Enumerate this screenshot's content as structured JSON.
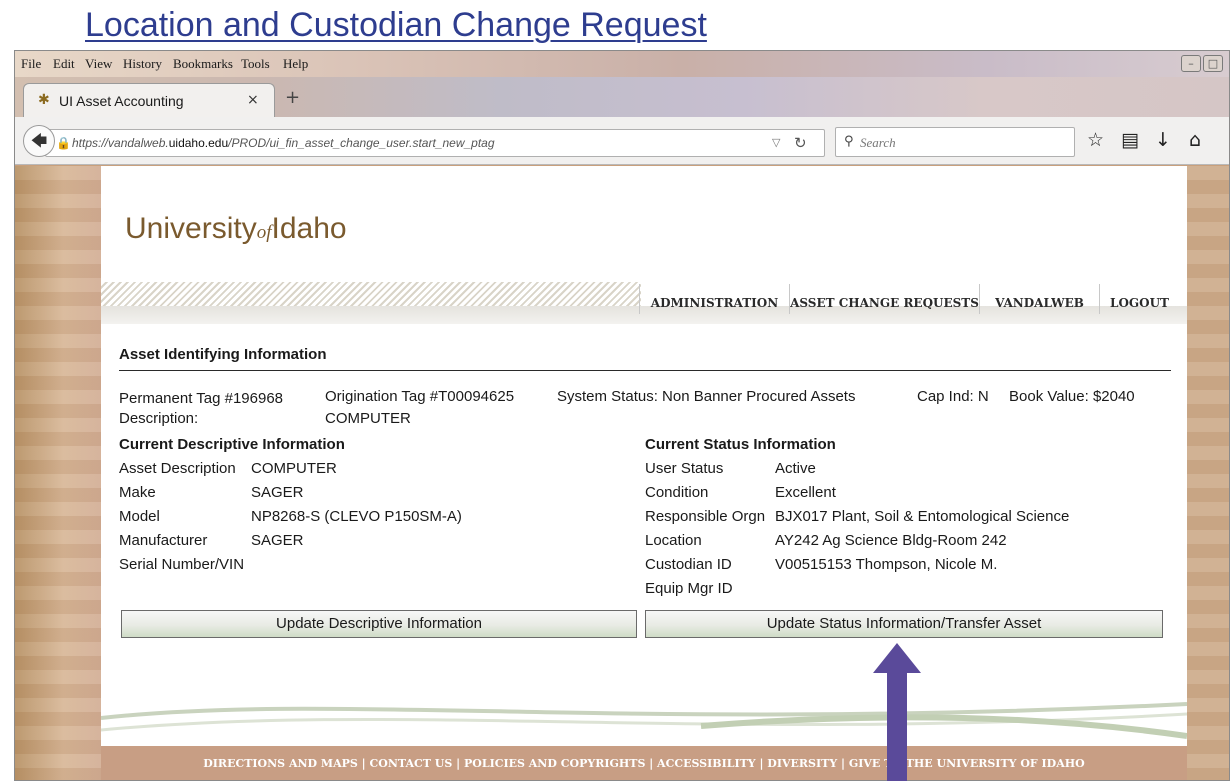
{
  "heading": "Location and Custodian Change Request",
  "menubar": {
    "items": [
      "File",
      "Edit",
      "View",
      "History",
      "Bookmarks",
      "Tools",
      "Help"
    ]
  },
  "tab": {
    "title": "UI Asset Accounting",
    "close": "×",
    "new_tab": "+"
  },
  "navbar": {
    "url_domain": "https://vandalweb.",
    "url_host": "uidaho.edu",
    "url_path": "/PROD/ui_fin_asset_change_user.start_new_ptag",
    "search_placeholder": "Search"
  },
  "site": {
    "logo_main": "University",
    "logo_of": "of",
    "logo_end": "Idaho",
    "nav": [
      "ADMINISTRATION",
      "ASSET CHANGE REQUESTS",
      "VANDALWEB",
      "LOGOUT"
    ]
  },
  "asset": {
    "section_title": "Asset Identifying Information",
    "permanent_tag": "Permanent Tag #196968",
    "origination_tag": "Origination Tag #T00094625",
    "system_status": "System Status: Non Banner Procured Assets",
    "cap_ind": "Cap Ind: N",
    "book_value": "Book Value: $2040",
    "description_label": "Description:",
    "description_value": "COMPUTER"
  },
  "descriptive": {
    "heading": "Current Descriptive Information",
    "rows": [
      {
        "label": "Asset Description",
        "value": "COMPUTER"
      },
      {
        "label": "Make",
        "value": "SAGER"
      },
      {
        "label": "Model",
        "value": "NP8268-S (CLEVO P150SM-A)"
      },
      {
        "label": "Manufacturer",
        "value": "SAGER"
      },
      {
        "label": "Serial Number/VIN",
        "value": ""
      }
    ]
  },
  "status": {
    "heading": "Current Status Information",
    "rows": [
      {
        "label": "User Status",
        "value": "Active"
      },
      {
        "label": "Condition",
        "value": "Excellent"
      },
      {
        "label": "Responsible Orgn",
        "value": "BJX017 Plant, Soil & Entomological Science"
      },
      {
        "label": "Location",
        "value": "AY242 Ag Science Bldg-Room 242"
      },
      {
        "label": "Custodian ID",
        "value": "V00515153 Thompson, Nicole M."
      },
      {
        "label": "Equip Mgr ID",
        "value": ""
      }
    ]
  },
  "buttons": {
    "update_descriptive": "Update Descriptive Information",
    "update_status": "Update Status Information/Transfer Asset"
  },
  "footer": {
    "text": "DIRECTIONS AND MAPS | CONTACT US | POLICIES AND COPYRIGHTS | ACCESSIBILITY | DIVERSITY | GIVE TO THE UNIVERSITY OF IDAHO"
  },
  "colors": {
    "heading": "#2e3d8f",
    "logo": "#7a5a2e",
    "arrow": "#5a4a9a",
    "footer_bg": "#c89e84"
  }
}
